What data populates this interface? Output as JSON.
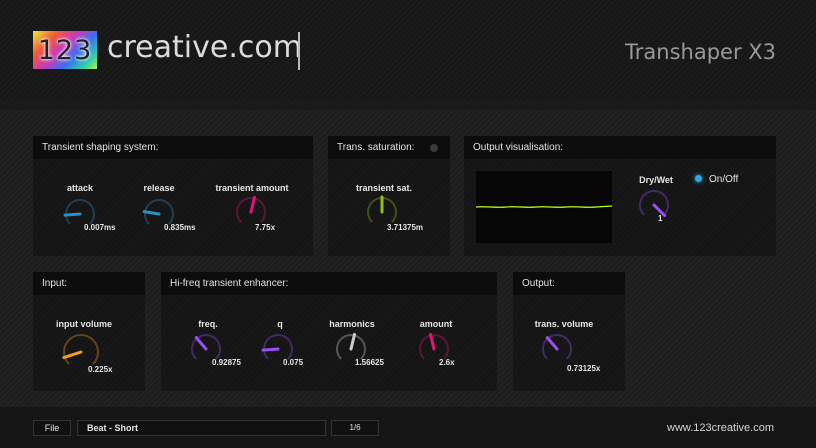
{
  "header": {
    "logo_number": "123",
    "logo_text": "creative.com",
    "product_name": "Transhaper X3"
  },
  "panels": {
    "transient_shaping": {
      "title": "Transient shaping system:",
      "knobs": [
        {
          "label": "attack",
          "value": "0.007ms",
          "level": 0.15,
          "color": "#2b8fc7"
        },
        {
          "label": "release",
          "value": "0.835ms",
          "level": 0.2,
          "color": "#2b8fc7"
        },
        {
          "label": "transient amount",
          "value": "7.75x",
          "level": 0.55,
          "color": "#e0157a"
        }
      ]
    },
    "trans_saturation": {
      "title": "Trans. saturation:",
      "led_color": "#3a3a3a",
      "knobs": [
        {
          "label": "transient sat.",
          "value": "3.71375m",
          "level": 0.5,
          "color": "#8fbf1a"
        }
      ]
    },
    "output_visualisation": {
      "title": "Output visualisation:",
      "waveform_color": "#b6ff2a",
      "dry_wet": {
        "label": "Dry/Wet",
        "value": "1",
        "level": 1.0,
        "color": "#9a50f0"
      },
      "onoff": {
        "label": "On/Off",
        "led_color": "#2ea8e0"
      }
    },
    "input": {
      "title": "Input:",
      "knobs": [
        {
          "label": "input volume",
          "value": "0.225x",
          "level": 0.1,
          "color": "#f0a020"
        }
      ]
    },
    "hifreq": {
      "title": "Hi-freq transient enhancer:",
      "knobs": [
        {
          "label": "freq.",
          "value": "0.92875",
          "level": 0.35,
          "color": "#9a50f0"
        },
        {
          "label": "q",
          "value": "0.075",
          "level": 0.15,
          "color": "#9a50f0"
        },
        {
          "label": "harmonics",
          "value": "1.56625",
          "level": 0.55,
          "color": "#cccccc"
        },
        {
          "label": "amount",
          "value": "2.6x",
          "level": 0.45,
          "color": "#e0157a"
        }
      ]
    },
    "output": {
      "title": "Output:",
      "knobs": [
        {
          "label": "trans. volume",
          "value": "0.73125x",
          "level": 0.35,
          "color": "#9a50f0"
        }
      ]
    }
  },
  "footer": {
    "file_label": "File",
    "preset_name": "Beat - Short",
    "preset_counter": "1/6",
    "website": "www.123creative.com"
  }
}
